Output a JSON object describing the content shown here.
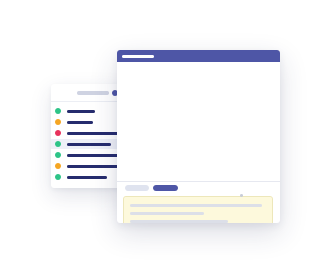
{
  "colors": {
    "accent": "#4e56a6",
    "navy_text": "#262c6e",
    "compose_background": "#fdf9dc",
    "send_button": "#24b77b",
    "placeholder_gray": "#dcdfe8"
  },
  "contact_list": {
    "header_icon": "status-dot-icon",
    "items": [
      {
        "status": "online",
        "status_color": "#2ec488"
      },
      {
        "status": "away",
        "status_color": "#f5a623"
      },
      {
        "status": "busy",
        "status_color": "#e8325c"
      },
      {
        "status": "online",
        "status_color": "#2ec488",
        "selected": true
      },
      {
        "status": "online",
        "status_color": "#2ec488"
      },
      {
        "status": "away",
        "status_color": "#f5a623"
      },
      {
        "status": "online",
        "status_color": "#2ec488"
      }
    ]
  },
  "main_window": {
    "compose_lines": 4,
    "toolbar_icons": [
      "emoji-icon",
      "attachment-icon",
      "image-icon",
      "file-icon"
    ],
    "tabs": [
      {
        "state": "inactive"
      },
      {
        "state": "active"
      }
    ],
    "buttons": [
      {
        "role": "primary"
      },
      {
        "role": "secondary"
      },
      {
        "role": "send"
      }
    ]
  }
}
